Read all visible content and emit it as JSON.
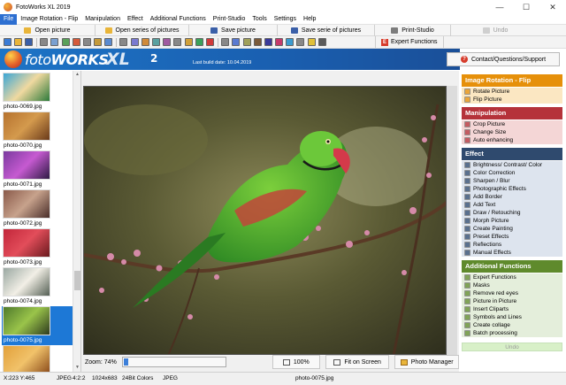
{
  "window": {
    "title": "FotoWorks XL 2019",
    "min_glyph": "—",
    "max_glyph": "☐",
    "close_glyph": "✕"
  },
  "menu": [
    {
      "label": "File",
      "active": true
    },
    {
      "label": "Image Rotation - Flip"
    },
    {
      "label": "Manipulation"
    },
    {
      "label": "Effect"
    },
    {
      "label": "Additional Functions"
    },
    {
      "label": "Print-Studio"
    },
    {
      "label": "Tools"
    },
    {
      "label": "Settings"
    },
    {
      "label": "Help"
    }
  ],
  "toolbar": {
    "open_picture": "Open picture",
    "open_series": "Open series of pictures",
    "save_picture": "Save picture",
    "save_series": "Save serie of pictures",
    "print_studio": "Print-Studio",
    "undo": "Undo",
    "expert_functions": "Expert Functions"
  },
  "banner": {
    "logo_foto": "foto",
    "logo_works": "WORKS",
    "logo_xl": "XL",
    "logo_ver": "2",
    "build_date": "Last build date: 10.04.2019",
    "contact": "Contact/Questions/Support"
  },
  "thumbnails": [
    {
      "label": "photo-0069.jpg",
      "colors": [
        "#3aa6d6",
        "#f0d9a0",
        "#2d7a3a"
      ]
    },
    {
      "label": "photo-0070.jpg",
      "colors": [
        "#b6722e",
        "#d49a4d",
        "#6a3a1a"
      ]
    },
    {
      "label": "photo-0071.jpg",
      "colors": [
        "#7a3a9e",
        "#c65ad1",
        "#2e1a44"
      ]
    },
    {
      "label": "photo-0072.jpg",
      "colors": [
        "#8a5a4a",
        "#c7a28c",
        "#4a2e2a"
      ]
    },
    {
      "label": "photo-0073.jpg",
      "colors": [
        "#c2263a",
        "#e24d5a",
        "#6a1a1e"
      ]
    },
    {
      "label": "photo-0074.jpg",
      "colors": [
        "#9aa8a2",
        "#f2efe6",
        "#556055"
      ]
    },
    {
      "label": "photo-0075.jpg",
      "colors": [
        "#4f7a2c",
        "#9ac44a",
        "#2e3a1e"
      ],
      "selected": true
    },
    {
      "label": "",
      "colors": [
        "#e2a03a",
        "#f1c26a",
        "#8a4a1a"
      ]
    }
  ],
  "zoom": {
    "label": "Zoom: 74%",
    "level_fraction": 0.0,
    "btn_100": "100%",
    "btn_fit": "Fit on Screen",
    "btn_manager": "Photo Manager"
  },
  "panel": {
    "sections": [
      {
        "title": "Image Rotation - Flip",
        "color": "#e6900a",
        "item_bg": "#fbe7c2",
        "items": [
          "Rotate Picture",
          "Flip Picture"
        ]
      },
      {
        "title": "Manipulation",
        "color": "#b5323a",
        "item_bg": "#f4d6d6",
        "items": [
          "Crop Picture",
          "Change Size",
          "Auto enhancing"
        ]
      },
      {
        "title": "Effect",
        "color": "#2f4a6e",
        "item_bg": "#dde4ee",
        "items": [
          "Brightness/ Contrast/ Color",
          "Color Correction",
          "Sharpen / Blur",
          "Photographic Effects",
          "Add Border",
          "Add Text",
          "Draw / Retouching",
          "Morph Picture",
          "Create Painting",
          "Preset Effects",
          "Reflections",
          "Manual Effects"
        ]
      },
      {
        "title": "Additional Functions",
        "color": "#5f8a2c",
        "item_bg": "#e4eedb",
        "items": [
          "Expert Functions",
          "Masks",
          "Remove red eyes",
          "Picture in Picture",
          "Insert Cliparts",
          "Symbols and Lines",
          "Create collage",
          "Batch processing"
        ]
      }
    ],
    "undo": "Undo"
  },
  "status": {
    "coords": "X:223 Y:465",
    "format": "JPEG",
    "sampling": "4:2:2",
    "dimensions": "1024x683",
    "colors": "24Bit Colors",
    "format2": "JPEG",
    "filename": "photo-0075.jpg"
  }
}
